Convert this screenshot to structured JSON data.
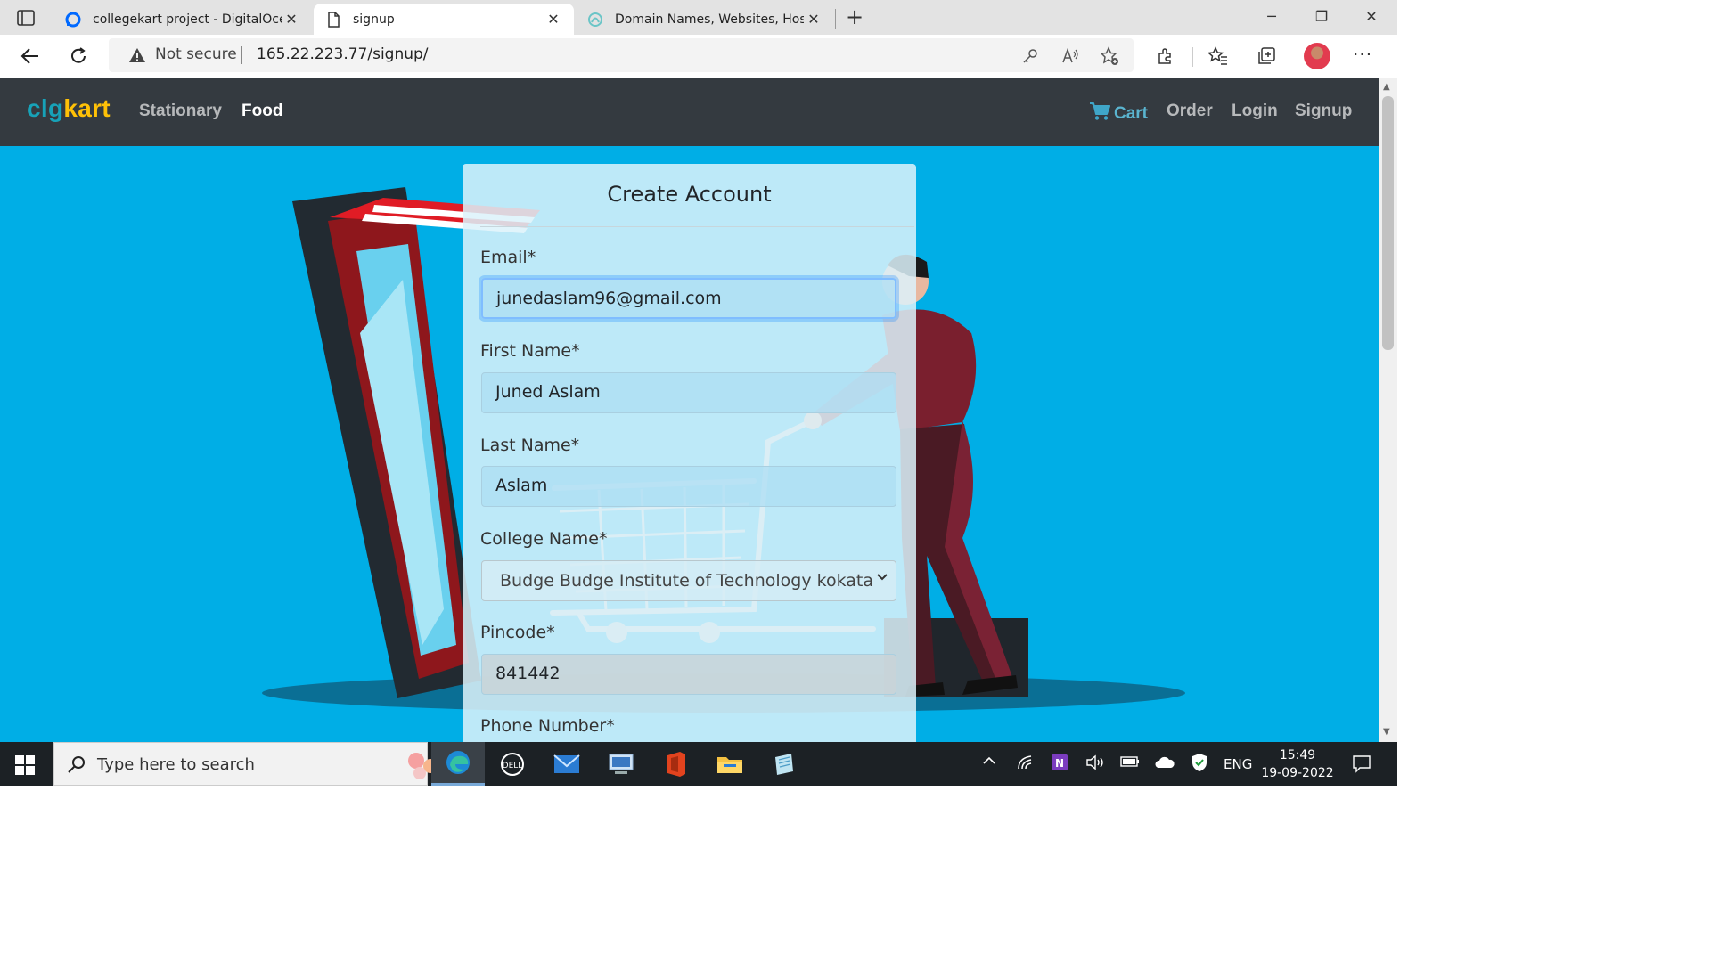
{
  "browser": {
    "tabs": [
      {
        "title": "collegekart project - DigitalOcean",
        "active": false
      },
      {
        "title": "signup",
        "active": true
      },
      {
        "title": "Domain Names, Websites, Hosting",
        "active": false
      }
    ],
    "security_label": "Not secure",
    "url": "165.22.223.77/signup/"
  },
  "site": {
    "brand_part1": "clg",
    "brand_part2": "kart",
    "nav_left": [
      "Stationary",
      "Food"
    ],
    "nav_right": [
      "Cart",
      "Order",
      "Login",
      "Signup"
    ]
  },
  "form": {
    "title": "Create Account",
    "fields": [
      {
        "label": "Email*",
        "value": "junedaslam96@gmail.com",
        "type": "input"
      },
      {
        "label": "First Name*",
        "value": "Juned Aslam",
        "type": "input"
      },
      {
        "label": "Last Name*",
        "value": "Aslam",
        "type": "input"
      },
      {
        "label": "College Name*",
        "value": "Budge Budge Institute of Technology kokata",
        "type": "select"
      },
      {
        "label": "Pincode*",
        "value": "841442",
        "type": "input"
      },
      {
        "label": "Phone Number*",
        "value": "",
        "type": "input"
      }
    ]
  },
  "taskbar": {
    "search_placeholder": "Type here to search",
    "language": "ENG",
    "time": "15:49",
    "date": "19-09-2022"
  },
  "colors": {
    "navbar": "#343a40",
    "hero": "#00aee6",
    "brand_primary": "#17a2b8",
    "brand_accent": "#ffc107"
  }
}
